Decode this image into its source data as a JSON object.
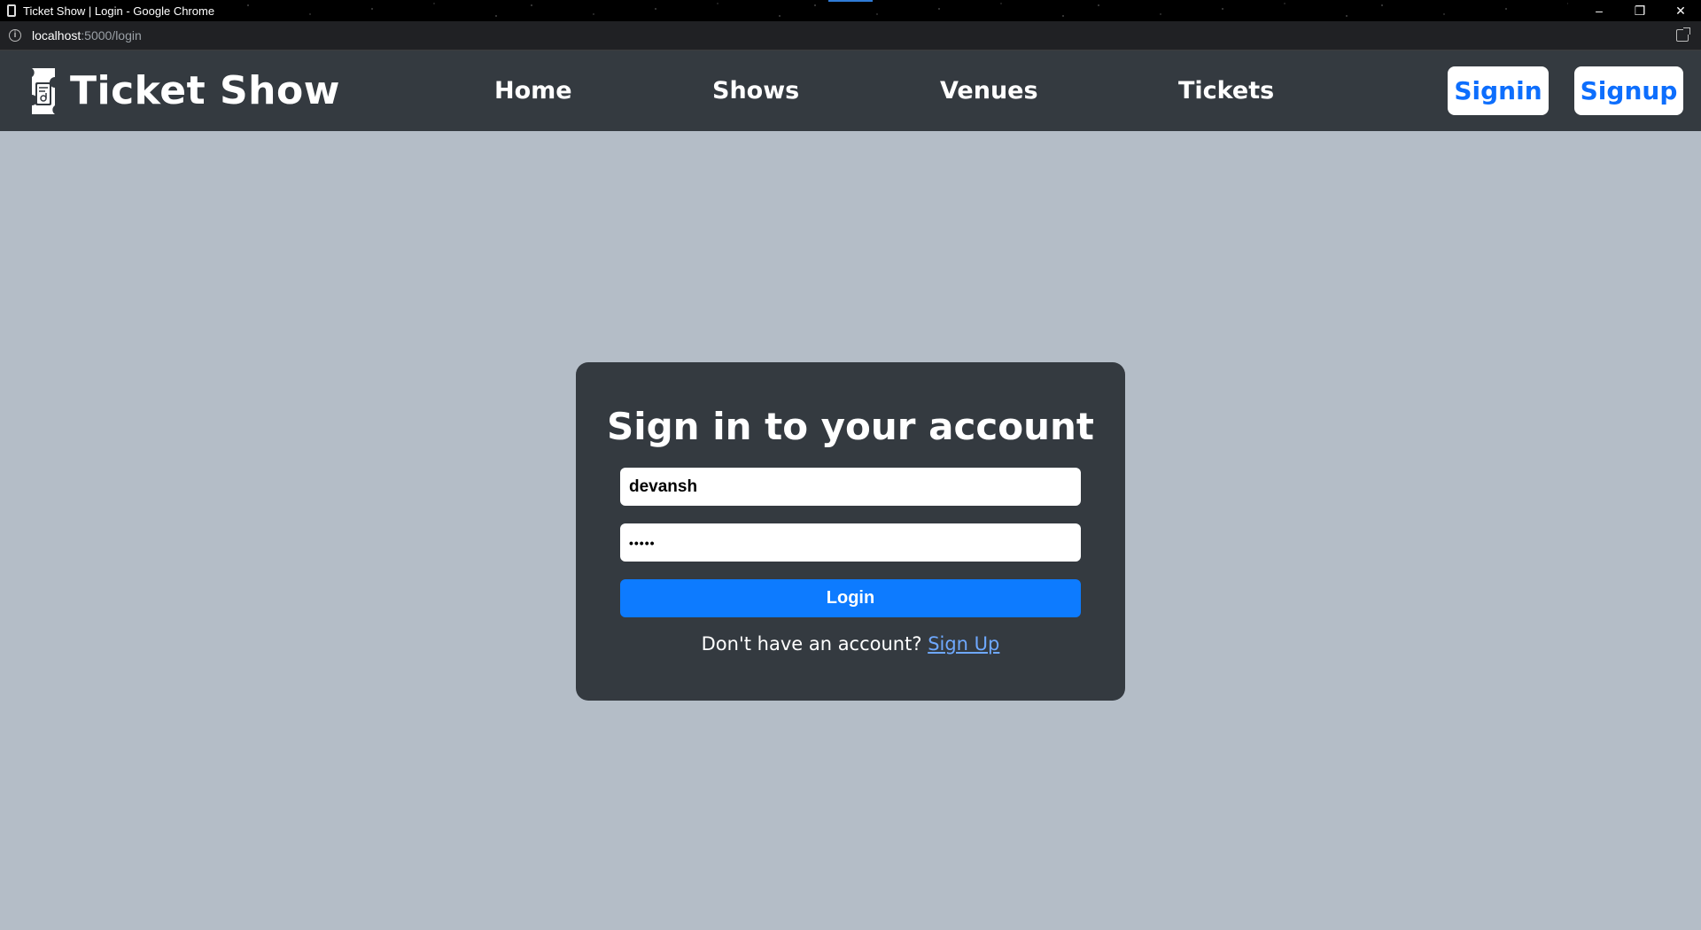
{
  "window": {
    "title": "Ticket Show | Login - Google Chrome",
    "controls": {
      "minimize": "–",
      "restore": "❐",
      "close": "✕"
    }
  },
  "address_bar": {
    "host": "localhost",
    "path": ":5000/login"
  },
  "navbar": {
    "brand": "Ticket Show",
    "links": [
      "Home",
      "Shows",
      "Venues",
      "Tickets"
    ],
    "signin_label": "Signin",
    "signup_label": "Signup",
    "background": "#343a40",
    "button_text_color": "#0d6efd"
  },
  "login": {
    "title": "Sign in to your account",
    "username_value": "devansh",
    "password_mask": "•••••",
    "button_label": "Login",
    "prompt_text": "Don't have an account?",
    "signup_link": "Sign Up",
    "button_color": "#0d7bff"
  },
  "page_background": "#b4bdc7"
}
